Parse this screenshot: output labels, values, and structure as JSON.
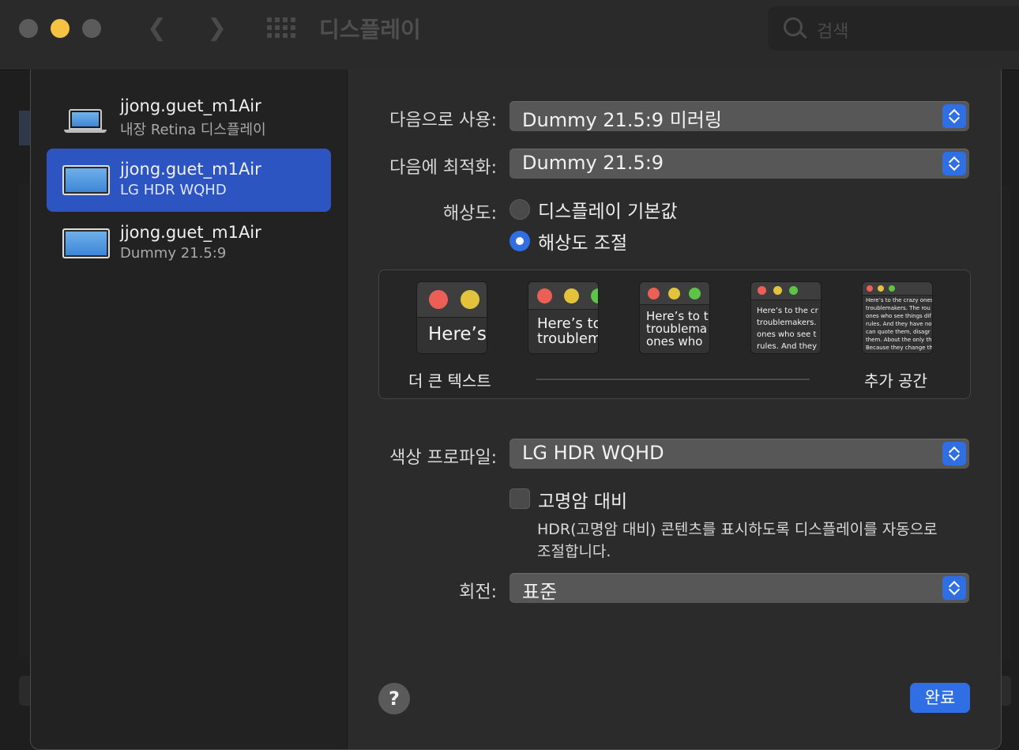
{
  "window": {
    "title": "디스플레이"
  },
  "search": {
    "placeholder": "검색"
  },
  "sidebar": {
    "items": [
      {
        "name": "jjong.guet_m1Air",
        "sub": "내장 Retina 디스플레이",
        "type": "laptop",
        "selected": false
      },
      {
        "name": "jjong.guet_m1Air",
        "sub": "LG HDR WQHD",
        "type": "monitor",
        "selected": true
      },
      {
        "name": "jjong.guet_m1Air",
        "sub": "Dummy 21.5:9",
        "type": "monitor",
        "selected": false
      }
    ]
  },
  "settings": {
    "use_as": {
      "label": "다음으로 사용:",
      "value": "Dummy 21.5:9 미러링"
    },
    "optimize_for": {
      "label": "다음에 최적화:",
      "value": "Dummy 21.5:9"
    },
    "resolution": {
      "label": "해상도:",
      "options": [
        {
          "label": "디스플레이 기본값",
          "selected": false
        },
        {
          "label": "해상도 조절",
          "selected": true
        }
      ]
    },
    "scaling": {
      "left_label": "더 큰 텍스트",
      "right_label": "추가 공간",
      "thumbs": [
        {
          "text": "Here’s"
        },
        {
          "text": "Here’s to\ntroublem"
        },
        {
          "text": "Here’s to t\ntroublema\nones who"
        },
        {
          "text": "Here’s to the cr\ntroublemakers.\nones who see t\nrules. And they"
        },
        {
          "text": "Here’s to the crazy ones\ntroublemakers. The rou\nones who see things dif\nrules. And they have no\ncan quote them, disagr\nthem. About the only th\nBecause they change th"
        }
      ]
    },
    "color_profile": {
      "label": "색상 프로파일:",
      "value": "LG HDR WQHD"
    },
    "hdr": {
      "label": "고명암 대비",
      "checked": false,
      "description": "HDR(고명암 대비) 콘텐츠를 표시하도록 디스플레이를 자동으로 조절합니다."
    },
    "rotation": {
      "label": "회전:",
      "value": "표준"
    }
  },
  "buttons": {
    "help": "?",
    "done": "완료"
  },
  "colors": {
    "accent": "#2f6ee3",
    "selected_row": "#2d55c1",
    "traffic_yellow": "#f5c242"
  },
  "icons": [
    "search-icon",
    "grid-icon",
    "back-arrow-icon",
    "forward-arrow-icon",
    "laptop-icon",
    "monitor-icon",
    "chevron-updown-icon"
  ]
}
